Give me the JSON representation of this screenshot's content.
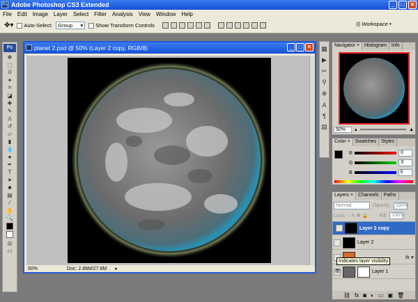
{
  "app": {
    "title": "Adobe Photoshop CS3 Extended"
  },
  "menu": [
    "File",
    "Edit",
    "Image",
    "Layer",
    "Select",
    "Filter",
    "Analysis",
    "View",
    "Window",
    "Help"
  ],
  "options": {
    "auto_select_label": "Auto-Select:",
    "auto_select_value": "Group",
    "show_transform_label": "Show Transform Controls",
    "workspace_label": "Workspace ▾"
  },
  "toolbar": {
    "ps_label": "Ps"
  },
  "document": {
    "title": "planet 2.psd @ 50% (Layer 2 copy, RGB/8)",
    "zoom": "50%",
    "doc_info": "Doc: 2.86M/27.6M"
  },
  "navigator": {
    "tabs": [
      "Navigator ×",
      "Histogram",
      "Info"
    ],
    "zoom": "50%"
  },
  "color": {
    "tabs": [
      "Color ×",
      "Swatches",
      "Styles"
    ],
    "channels": [
      {
        "label": "R",
        "value": "0",
        "color": "#e02020"
      },
      {
        "label": "G",
        "value": "0",
        "color": "#20b020"
      },
      {
        "label": "B",
        "value": "0",
        "color": "#2040e0"
      }
    ]
  },
  "layers": {
    "tabs": [
      "Layers ×",
      "Channels",
      "Paths"
    ],
    "blend_mode": "Normal",
    "opacity_label": "Opacity:",
    "opacity_value": "100%",
    "lock_label": "Lock:",
    "fill_label": "Fill:",
    "fill_value": "100%",
    "items": [
      {
        "name": "Layer 2 copy",
        "selected": true
      },
      {
        "name": "Layer 2",
        "selected": false
      },
      {
        "name": "",
        "selected": false
      },
      {
        "name": "Layer 1",
        "selected": false
      }
    ],
    "tooltip": "Indicates layer visibility"
  }
}
